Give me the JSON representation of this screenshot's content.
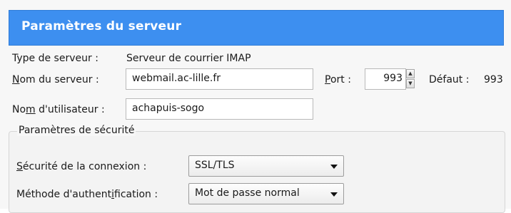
{
  "header": {
    "title": "Paramètres du serveur"
  },
  "server_type": {
    "label": "Type de serveur :",
    "value": "Serveur de courrier IMAP"
  },
  "server_name": {
    "label_u": "N",
    "label_rest": "om du serveur :",
    "value": "webmail.ac-lille.fr"
  },
  "port": {
    "label_u": "P",
    "label_rest": "ort :",
    "value": "993",
    "default_label": "Défaut :",
    "default_value": "993"
  },
  "username": {
    "label_a": "No",
    "label_u": "m",
    "label_b": " d'utilisateur :",
    "value": "achapuis-sogo"
  },
  "security": {
    "group_title": "Paramètres de sécurité",
    "connection_label_u": "S",
    "connection_label_rest": "écurité de la connexion :",
    "connection_value": "SSL/TLS",
    "auth_label_a": "Méthode d'authent",
    "auth_label_u": "i",
    "auth_label_b": "fication :",
    "auth_value": "Mot de passe normal"
  },
  "icons": {
    "spin_up": "spin-up-icon",
    "spin_down": "spin-down-icon",
    "dropdown": "chevron-down-icon"
  }
}
